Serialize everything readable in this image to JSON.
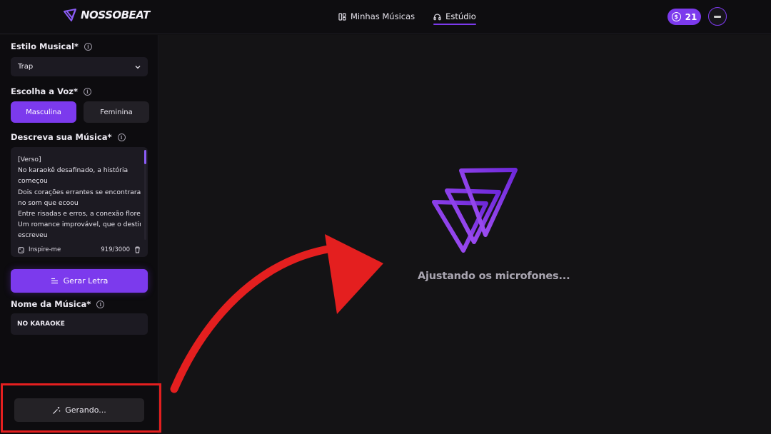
{
  "header": {
    "logo_text": "NOSSOBEAT",
    "nav": [
      {
        "label": "Minhas Músicas",
        "icon": "library-icon",
        "active": false
      },
      {
        "label": "Estúdio",
        "icon": "headphones-icon",
        "active": true
      }
    ],
    "credits": "21",
    "credits_icon": "dollar-coin-icon"
  },
  "sidebar": {
    "style_label": "Estilo Musical*",
    "style_value": "Trap",
    "voice_label": "Escolha a Voz*",
    "voice_options": [
      "Masculina",
      "Feminina"
    ],
    "voice_selected": "Masculina",
    "describe_label": "Descreva sua Música*",
    "lyrics_lines": [
      "[Verso]",
      "No karaokê desafinado, a história",
      "começou",
      "Dois corações errantes se encontraram,",
      "no som que ecoou",
      "Entre risadas e erros, a conexão floresceu",
      "Um romance improvável, que o destino",
      "escreveu"
    ],
    "inspire_label": "Inspire-me",
    "char_count": "919/3000",
    "generate_lyrics_label": "Gerar Letra",
    "song_name_label": "Nome da Música*",
    "song_name_value": "NO KARAOKE",
    "generating_label": "Gerando..."
  },
  "main": {
    "status_text": "Ajustando os microfones..."
  },
  "colors": {
    "accent": "#7c3aed",
    "annotation_red": "#e41f1f"
  }
}
